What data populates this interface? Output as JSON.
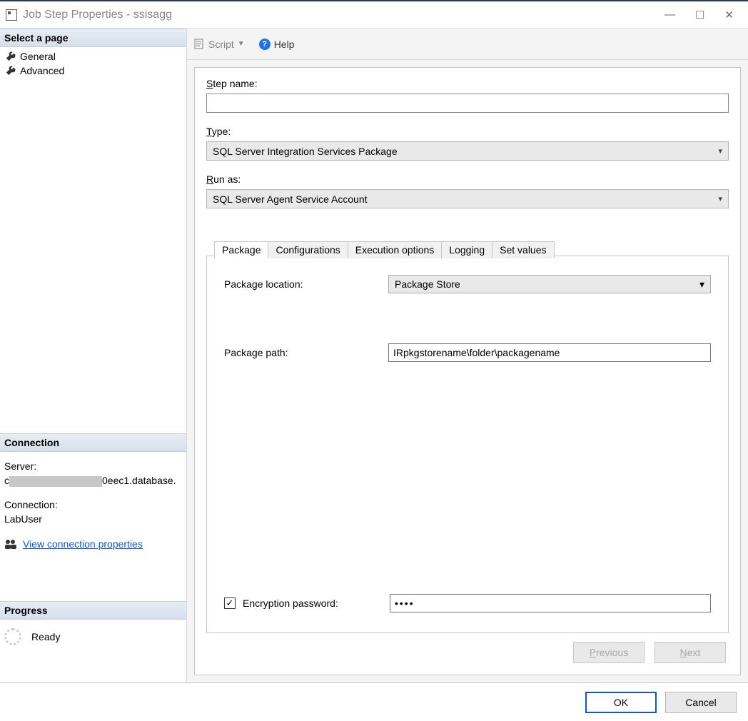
{
  "window": {
    "title": "Job Step Properties - ssisagg",
    "min_icon": "—",
    "max_icon": "☐",
    "close_icon": "✕"
  },
  "sidebar": {
    "select_page_header": "Select a page",
    "items": [
      {
        "label": "General"
      },
      {
        "label": "Advanced"
      }
    ],
    "connection_header": "Connection",
    "server_label": "Server:",
    "server_value_suffix": "0eec1.database.",
    "connection_label": "Connection:",
    "connection_value": "LabUser",
    "view_conn_props": "View connection properties",
    "progress_header": "Progress",
    "progress_value": "Ready"
  },
  "toolbar": {
    "script_label": "Script",
    "help_label": "Help"
  },
  "form": {
    "step_name_label": "tep name:",
    "step_name_prefix": "S",
    "step_name_value": "",
    "type_label": "ype:",
    "type_prefix": "T",
    "type_value": "SQL Server Integration Services Package",
    "run_as_label": "un as:",
    "run_as_prefix": "R",
    "run_as_value": "SQL Server Agent Service Account"
  },
  "tabs": {
    "items": [
      "Package",
      "Configurations",
      "Execution options",
      "Logging",
      "Set values"
    ]
  },
  "package": {
    "location_label": "Package location:",
    "location_value": "Package Store",
    "path_prefix": "Package pat",
    "path_underline": "h",
    "path_suffix": ":",
    "path_value": "IRpkgstorename\\folder\\packagename",
    "enc_prefix": "E",
    "enc_label": "ncryption password:",
    "enc_value": "••••"
  },
  "buttons": {
    "previous": "Previous",
    "next_prefix": "N",
    "next_suffix": "ext",
    "ok": "OK",
    "cancel": "Cancel"
  }
}
